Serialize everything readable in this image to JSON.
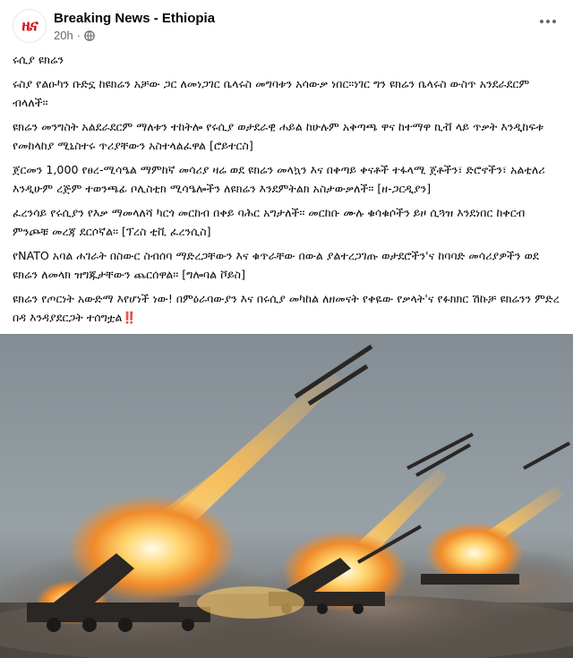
{
  "post": {
    "page_name": "Breaking News - Ethiopia",
    "avatar_text": "ዜና",
    "time": "20h",
    "separator": "·",
    "paragraphs": [
      "ሩሲያ ዩክሬን",
      "ሩስያ የልዑካን ቡድኗ ከዩክሬን አቻው ጋር ለመነጋገር ቤላሩስ መግባቱን አሳውቃ ነበር፡፡ነገር ግን ዩክሬን ቤላሩስ ውስጥ አንደራደርም ብላለች፡፡",
      "ዩክሬን መንግስት አልደራደርም ማለቱን ተከትሎ የሩሲያ ወታደራዊ ሐይል ከሁሉም አቅጣጫ ዋና ከተማዋ ኪቭ ላይ ጥቃት እንዲከፍቱ የመከላከያ ሚኒስተሩ ጥሪያቸውን አስተላልፈዋል [ሮይተርስ]",
      "ጀርመን 1,000 የፀረ-ሚሳዔል ማምከኛ መሳሪያ ዛሬ ወደ ዩክሬን መላኳን እና በቀጣይ ቀናቶች ተፋላሚ ጀቶችን፣ ድሮኖችን፣ አልቲለሪ እንዲሁም ረጅም ተወንጫፊ ቦሊስቲክ ሚሳዔሎችን ለዩክሬን እንደምትልክ አስታውቃለች፡፡ [ዘ-ጋርዲያን]",
      "ፈረንሳይ የሩሲያን የእቃ ማመላለሻ ካርጎ መርከብ በቀይ ባሕር አግታለች፡፡ መርከቡ ሙሉ ቁሳቁሶችን ይዞ ሲጓዝ እንደነበር ከቀርብ ምንጮቹ መረጃ ደርሶኛል፡፡ [ፕረስ ቲቪ ፈረንሲስ]",
      "የNATO አባል ሐገራት በስውር ስብሰባ ማድረጋቸውን እና ቁጥራቸው በውል ያልተረጋገጡ ወታደሮችን'ና ከባባድ መሳሪያዎችን ወደ ዩክሬን ለመላክ ዝግጁታቸውን ጨርሰዋል፡፡ [ግሎባል ቮይስ]",
      "ዩክሬን የጦርነት አውድማ እየሆነች ነው! በምዕራባውያን እና በሩሲያ መካከል ለዘመናት የቀዬው የቃላት'ና የፉክክር ሽኩቻ ዩክሬንን ምድረ በዳ እንዳያደርጋት ተሰግቷል"
    ],
    "final_emoji": "‼️"
  },
  "photo": {
    "alt_subject": "rocket launchers firing",
    "colors": {
      "sky": "#8e989e",
      "fire": "#ffb347",
      "smoke": "#5b5551"
    }
  },
  "icons": {
    "privacy": "globe-icon",
    "menu": "more-options-icon"
  }
}
